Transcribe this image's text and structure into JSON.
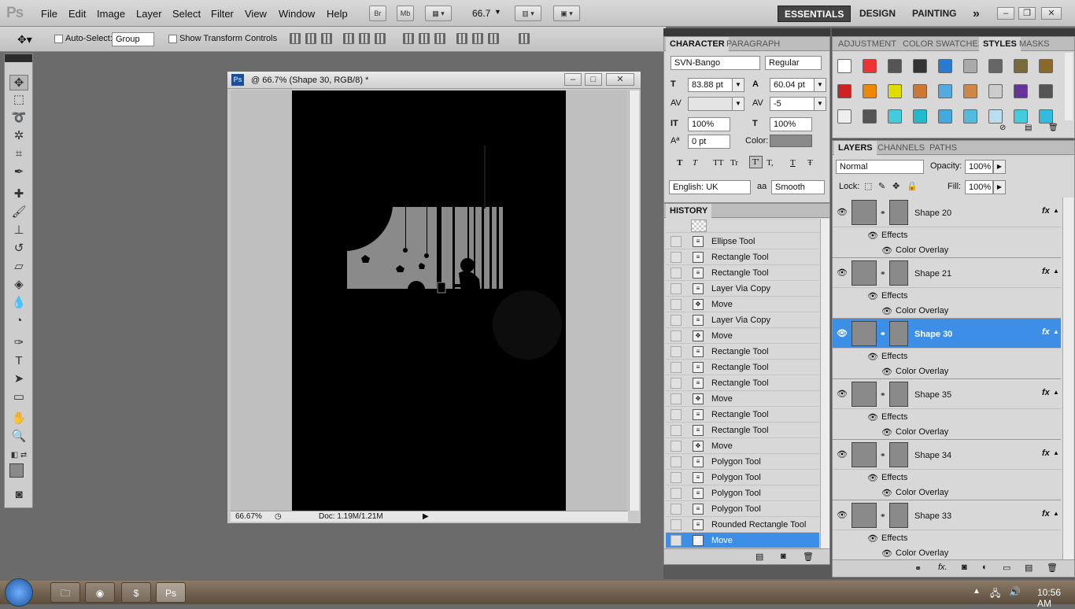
{
  "app": {
    "logo": "Ps"
  },
  "menu": [
    "File",
    "Edit",
    "Image",
    "Layer",
    "Select",
    "Filter",
    "View",
    "Window",
    "Help"
  ],
  "appbar": {
    "bridge": "Br",
    "minibridge": "Mb",
    "zoom": "66.7"
  },
  "workspaces": [
    "ESSENTIALS",
    "DESIGN",
    "PAINTING"
  ],
  "workspace_more": "»",
  "options": {
    "auto_select": "Auto-Select:",
    "auto_select_value": "Group",
    "show_transform": "Show Transform Controls"
  },
  "document": {
    "title": "@ 66.7% (Shape 30, RGB/8) *",
    "zoom": "66.67%",
    "doc_size": "Doc: 1.19M/1.21M"
  },
  "character_panel": {
    "tabs": [
      "CHARACTER",
      "PARAGRAPH"
    ],
    "font_family": "SVN-Bango",
    "font_style": "Regular",
    "size": "83.88 pt",
    "leading": "60.04 pt",
    "kerning": "",
    "tracking": "-5",
    "vscale": "100%",
    "hscale": "100%",
    "baseline": "0 pt",
    "color_label": "Color:",
    "styles": [
      "T",
      "T",
      "TT",
      "Tr",
      "T'",
      "T,",
      "T",
      "Ŧ"
    ],
    "language": "English: UK",
    "aa_label": "aa",
    "antialias": "Smooth"
  },
  "history_panel": {
    "tab": "HISTORY",
    "items": [
      "Ellipse Tool",
      "Rectangle Tool",
      "Rectangle Tool",
      "Layer Via Copy",
      "Move",
      "Layer Via Copy",
      "Move",
      "Rectangle Tool",
      "Rectangle Tool",
      "Rectangle Tool",
      "Move",
      "Rectangle Tool",
      "Rectangle Tool",
      "Move",
      "Polygon Tool",
      "Polygon Tool",
      "Polygon Tool",
      "Polygon Tool",
      "Rounded Rectangle Tool",
      "Move"
    ],
    "selected_index": 19
  },
  "styles_panel": {
    "tabs": [
      "ADJUSTMENT",
      "COLOR",
      "SWATCHES",
      "STYLES",
      "MASKS"
    ]
  },
  "layers_panel": {
    "tabs": [
      "LAYERS",
      "CHANNELS",
      "PATHS"
    ],
    "blend_mode": "Normal",
    "opacity_label": "Opacity:",
    "opacity": "100%",
    "lock_label": "Lock:",
    "fill_label": "Fill:",
    "fill": "100%",
    "layers": [
      {
        "name": "Shape 20",
        "effects": "Effects",
        "overlay": "Color Overlay",
        "selected": false
      },
      {
        "name": "Shape 21",
        "effects": "Effects",
        "overlay": "Color Overlay",
        "selected": false
      },
      {
        "name": "Shape 30",
        "effects": "Effects",
        "overlay": "Color Overlay",
        "selected": true
      },
      {
        "name": "Shape 35",
        "effects": "Effects",
        "overlay": "Color Overlay",
        "selected": false
      },
      {
        "name": "Shape 34",
        "effects": "Effects",
        "overlay": "Color Overlay",
        "selected": false
      },
      {
        "name": "Shape 33",
        "effects": "Effects",
        "overlay": "Color Overlay",
        "selected": false
      }
    ],
    "fx": "fx"
  },
  "taskbar": {
    "time": "10:56 AM"
  },
  "colors": {
    "accent": "#3d8ee6",
    "canvas": "#000000",
    "scene_gray": "#8a8a8a"
  }
}
